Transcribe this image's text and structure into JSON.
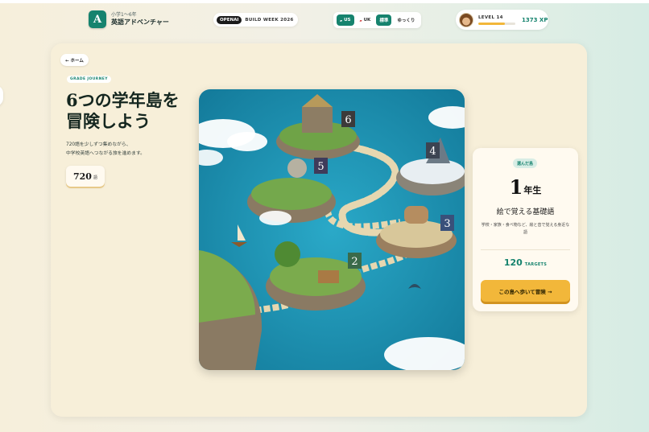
{
  "header": {
    "brand": {
      "logo_letter": "A",
      "subtitle": "小学1〜6年",
      "title": "英語アドベンチャー"
    },
    "event": {
      "tag": "OPENAI",
      "label": "BUILD WEEK 2026"
    },
    "accent_toggle": {
      "options": [
        "US",
        "UK"
      ],
      "selected": "US",
      "speed_label": "標準",
      "speed_alt": "ゆっくり"
    },
    "level": {
      "label": "LEVEL 14",
      "xp": "1373 XP",
      "progress": 0.72
    }
  },
  "main": {
    "home_button": "← ホーム",
    "badge": "GRADE JOURNEY",
    "headline_line1": "6つの学年島を",
    "headline_line2": "冒険しよう",
    "description_line1": "720語を少しずつ集めながら、",
    "description_line2": "中学校英語へつながる旅を進めます。",
    "word_total": {
      "number": "720",
      "unit": "語"
    }
  },
  "map": {
    "island_numbers": [
      "6",
      "5",
      "4",
      "3",
      "2"
    ]
  },
  "selected_island": {
    "badge": "選んだ島",
    "grade_number": "1",
    "grade_suffix": "年生",
    "title": "絵で覚える基礎語",
    "description": "学校・家族・食べ物など、絵と音で覚える身近な語",
    "targets_number": "120",
    "targets_label": "TARGETS",
    "cta": "この島へ歩いて冒険 →"
  },
  "colors": {
    "brand": "#16836e",
    "accent": "#f2b73a",
    "card": "#f7efd9"
  }
}
